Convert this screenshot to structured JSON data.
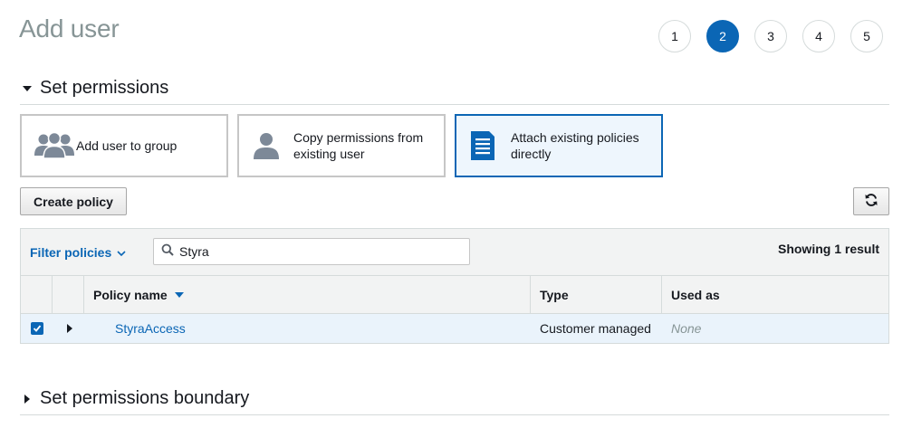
{
  "page": {
    "title": "Add user"
  },
  "steps": [
    "1",
    "2",
    "3",
    "4",
    "5"
  ],
  "active_step": 2,
  "permissions_section": {
    "title": "Set permissions",
    "options": [
      {
        "label": "Add user to group",
        "icon": "user-group-icon",
        "selected": false
      },
      {
        "label": "Copy permissions from existing user",
        "icon": "user-icon",
        "selected": false
      },
      {
        "label": "Attach existing policies directly",
        "icon": "document-icon",
        "selected": true
      }
    ]
  },
  "toolbar": {
    "create_policy_label": "Create policy",
    "refresh_icon": "refresh-icon"
  },
  "policy_table": {
    "filter_label": "Filter policies",
    "search_value": "Styra",
    "result_count": "Showing 1 result",
    "columns": {
      "policy_name": "Policy name",
      "type": "Type",
      "used_as": "Used as"
    },
    "rows": [
      {
        "checked": true,
        "policy_name": "StyraAccess",
        "type": "Customer managed",
        "used_as": "None"
      }
    ]
  },
  "boundary_section": {
    "title": "Set permissions boundary"
  },
  "colors": {
    "accent": "#0b66b5",
    "muted": "#879596",
    "selected_bg": "#eef6fd"
  }
}
